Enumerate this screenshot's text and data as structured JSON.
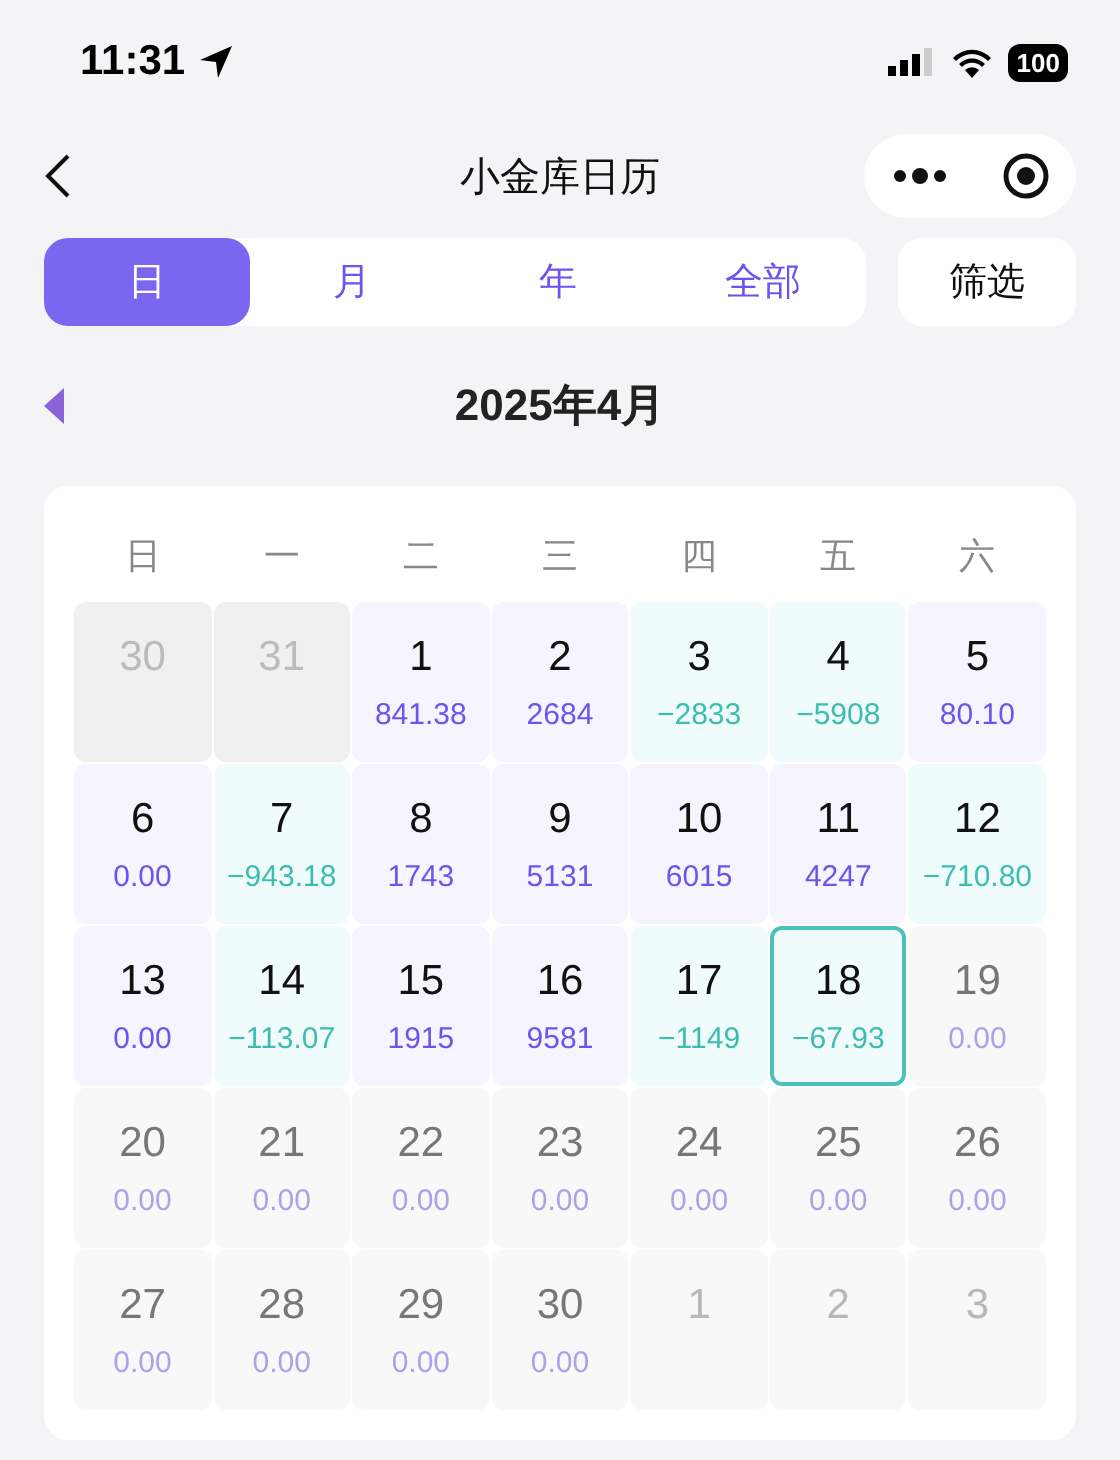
{
  "status_bar": {
    "time": "11:31",
    "battery": "100"
  },
  "nav": {
    "title": "小金库日历"
  },
  "tabs": [
    {
      "label": "日",
      "selected": true
    },
    {
      "label": "月",
      "selected": false
    },
    {
      "label": "年",
      "selected": false
    },
    {
      "label": "全部",
      "selected": false
    }
  ],
  "filter_button": "筛选",
  "month_title": "2025年4月",
  "weekdays": [
    "日",
    "一",
    "二",
    "三",
    "四",
    "五",
    "六"
  ],
  "days": [
    {
      "day": "30",
      "kind": "prev",
      "selected": false
    },
    {
      "day": "31",
      "kind": "prev",
      "selected": false
    },
    {
      "day": "1",
      "amount": "841.38",
      "kind": "gain",
      "selected": false
    },
    {
      "day": "2",
      "amount": "2684",
      "kind": "gain",
      "selected": false
    },
    {
      "day": "3",
      "amount": "−2833",
      "kind": "loss",
      "selected": false
    },
    {
      "day": "4",
      "amount": "−5908",
      "kind": "loss",
      "selected": false
    },
    {
      "day": "5",
      "amount": "80.10",
      "kind": "gain",
      "selected": false
    },
    {
      "day": "6",
      "amount": "0.00",
      "kind": "gain",
      "selected": false
    },
    {
      "day": "7",
      "amount": "−943.18",
      "kind": "loss",
      "selected": false
    },
    {
      "day": "8",
      "amount": "1743",
      "kind": "gain",
      "selected": false
    },
    {
      "day": "9",
      "amount": "5131",
      "kind": "gain",
      "selected": false
    },
    {
      "day": "10",
      "amount": "6015",
      "kind": "gain",
      "selected": false
    },
    {
      "day": "11",
      "amount": "4247",
      "kind": "gain",
      "selected": false
    },
    {
      "day": "12",
      "amount": "−710.80",
      "kind": "loss",
      "selected": false
    },
    {
      "day": "13",
      "amount": "0.00",
      "kind": "gain",
      "selected": false
    },
    {
      "day": "14",
      "amount": "−113.07",
      "kind": "loss",
      "selected": false
    },
    {
      "day": "15",
      "amount": "1915",
      "kind": "gain",
      "selected": false
    },
    {
      "day": "16",
      "amount": "9581",
      "kind": "gain",
      "selected": false
    },
    {
      "day": "17",
      "amount": "−1149",
      "kind": "loss",
      "selected": false
    },
    {
      "day": "18",
      "amount": "−67.93",
      "kind": "loss",
      "selected": true
    },
    {
      "day": "19",
      "amount": "0.00",
      "kind": "future",
      "selected": false
    },
    {
      "day": "20",
      "amount": "0.00",
      "kind": "future",
      "selected": false
    },
    {
      "day": "21",
      "amount": "0.00",
      "kind": "future",
      "selected": false
    },
    {
      "day": "22",
      "amount": "0.00",
      "kind": "future",
      "selected": false
    },
    {
      "day": "23",
      "amount": "0.00",
      "kind": "future",
      "selected": false
    },
    {
      "day": "24",
      "amount": "0.00",
      "kind": "future",
      "selected": false
    },
    {
      "day": "25",
      "amount": "0.00",
      "kind": "future",
      "selected": false
    },
    {
      "day": "26",
      "amount": "0.00",
      "kind": "future",
      "selected": false
    },
    {
      "day": "27",
      "amount": "0.00",
      "kind": "future",
      "selected": false
    },
    {
      "day": "28",
      "amount": "0.00",
      "kind": "future",
      "selected": false
    },
    {
      "day": "29",
      "amount": "0.00",
      "kind": "future",
      "selected": false
    },
    {
      "day": "30",
      "amount": "0.00",
      "kind": "future",
      "selected": false
    },
    {
      "day": "1",
      "kind": "next",
      "selected": false
    },
    {
      "day": "2",
      "kind": "next",
      "selected": false
    },
    {
      "day": "3",
      "kind": "next",
      "selected": false
    }
  ]
}
